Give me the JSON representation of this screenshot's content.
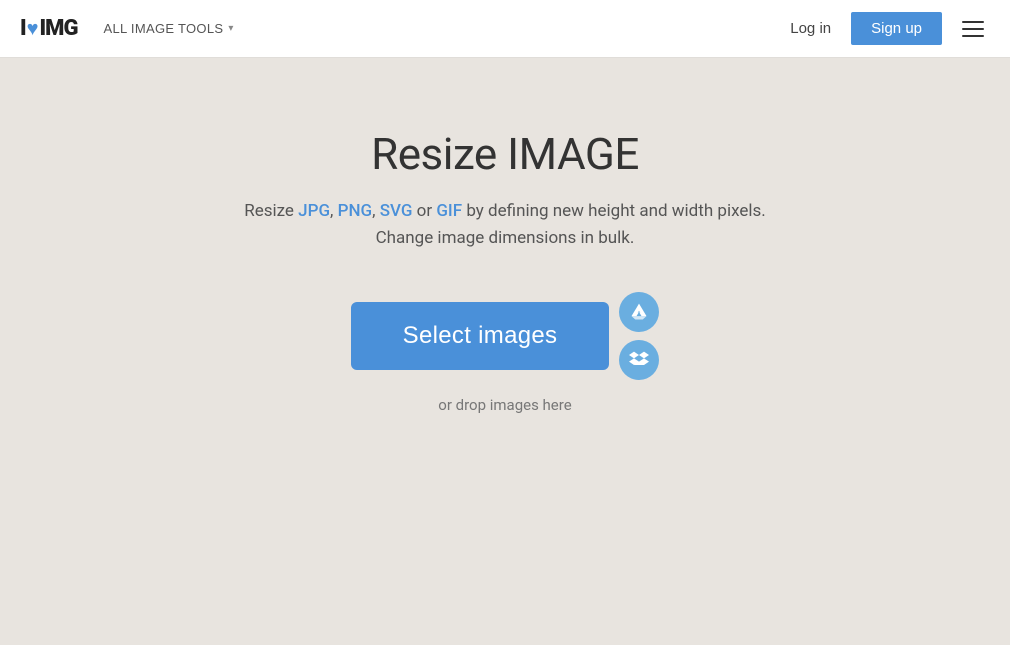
{
  "header": {
    "logo_i": "I",
    "logo_heart": "♥",
    "logo_img": "IMG",
    "all_tools_label": "ALL IMAGE TOOLS",
    "login_label": "Log in",
    "signup_label": "Sign up"
  },
  "main": {
    "title": "Resize IMAGE",
    "description_before": "Resize ",
    "format_jpg": "JPG",
    "comma1": ",",
    "format_png": "PNG",
    "comma2": ",",
    "format_svg": "SVG",
    "or_text": " or ",
    "format_gif": "GIF",
    "description_after": " by defining new height and width pixels.",
    "description_line2": "Change image dimensions in bulk.",
    "select_button_label": "Select images",
    "drop_text": "or drop images here"
  }
}
